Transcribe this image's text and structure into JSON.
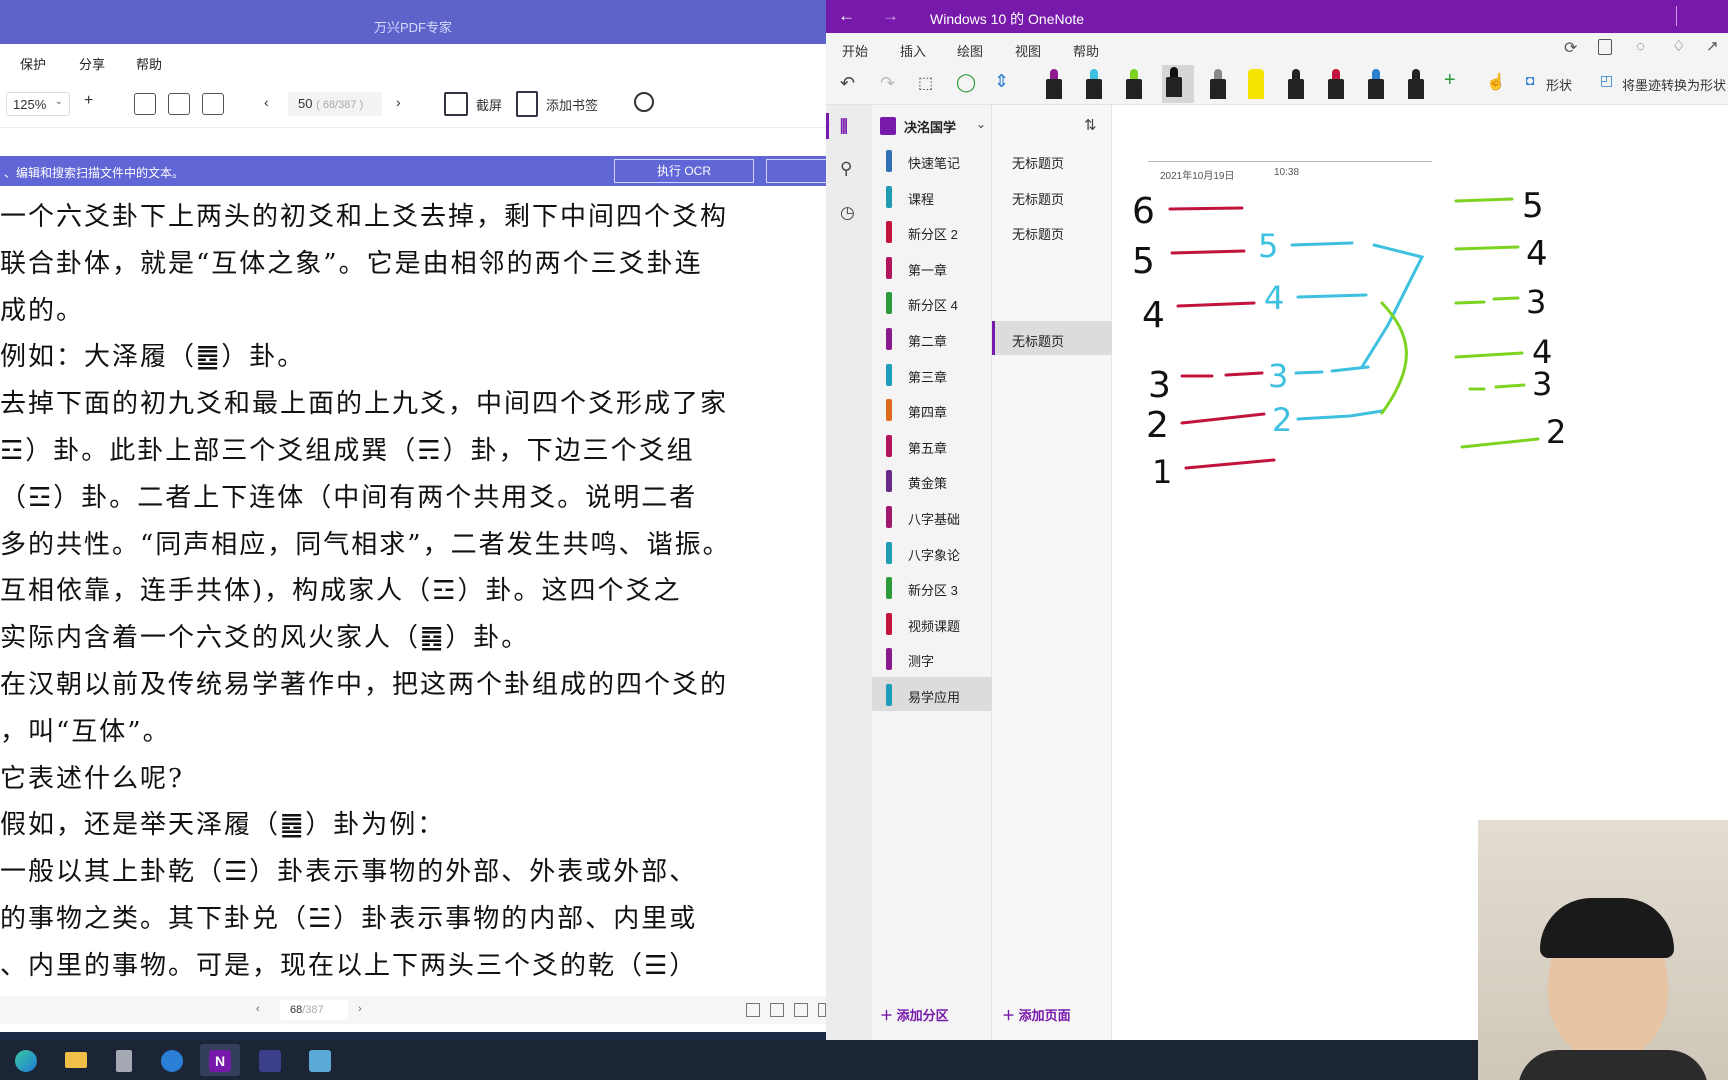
{
  "pdf": {
    "title": "万兴PDF专家",
    "menu": [
      "保护",
      "分享",
      "帮助"
    ],
    "zoom": "125%",
    "zoom_plus": "+",
    "page_current": "50",
    "page_range": "( 68/387 )",
    "screenshot_label": "截屏",
    "bookmark_label": "添加书签",
    "ocr_message": "、编辑和搜索扫描文件中的文本。",
    "ocr_button": "执行 OCR",
    "text_lines": [
      "一个六爻卦下上两头的初爻和上爻去掉，剩下中间四个爻构",
      "联合卦体，就是“互体之象”。它是由相邻的两个三爻卦连",
      "成的。",
      "例如：大泽履（䷉）卦。",
      "去掉下面的初九爻和最上面的上九爻，中间四个爻形成了家",
      "☲）卦。此卦上部三个爻组成巽（☴）卦，下边三个爻组",
      "（☲）卦。二者上下连体（中间有两个共用爻。说明二者",
      "多的共性。“同声相应，同气相求”，二者发生共鸣、谐振。",
      "互相依靠，连手共体)，构成家人（☲）卦。这四个爻之",
      "实际内含着一个六爻的风火家人（䷤）卦。",
      "在汉朝以前及传统易学著作中，把这两个卦组成的四个爻的",
      "，叫“互体”。",
      "它表述什么呢?",
      "假如，还是举天泽履（䷉）卦为例：",
      "一般以其上卦乾（☰）卦表示事物的外部、外表或外部、",
      "的事物之类。其下卦兑（☱）卦表示事物的内部、内里或",
      "、内里的事物。可是，现在以上下两头三个爻的乾（☰）"
    ],
    "status_page": "68",
    "status_total": "/387"
  },
  "onenote": {
    "title": "Windows 10 的 OneNote",
    "tabs": [
      "开始",
      "插入",
      "绘图",
      "视图",
      "帮助"
    ],
    "active_tab": "绘图",
    "ribbon_shape": "形状",
    "ribbon_convert": "将墨迹转换为形状",
    "notebook": "决洺国学",
    "sections": [
      {
        "label": "快速笔记",
        "color": "#2e6fb8"
      },
      {
        "label": "课程",
        "color": "#1f9bb2"
      },
      {
        "label": "新分区 2",
        "color": "#c4143c"
      },
      {
        "label": "第一章",
        "color": "#b1135d"
      },
      {
        "label": "新分区 4",
        "color": "#2a9a3a"
      },
      {
        "label": "第二章",
        "color": "#8b1a8f"
      },
      {
        "label": "第三章",
        "color": "#1c9dba"
      },
      {
        "label": "第四章",
        "color": "#e06a1c"
      },
      {
        "label": "第五章",
        "color": "#b1135d"
      },
      {
        "label": "黄金策",
        "color": "#6a2a8a"
      },
      {
        "label": "八字基础",
        "color": "#a0186e"
      },
      {
        "label": "八字象论",
        "color": "#1f9bb2"
      },
      {
        "label": "新分区 3",
        "color": "#2a9a3a"
      },
      {
        "label": "视频课题",
        "color": "#c4143c"
      },
      {
        "label": "测字",
        "color": "#8b1a8f"
      },
      {
        "label": "易学应用",
        "color": "#1c9dba"
      }
    ],
    "active_section": "易学应用",
    "pages": [
      "无标题页",
      "无标题页",
      "无标题页",
      "",
      "",
      "无标题页"
    ],
    "active_page_index": 5,
    "add_section": "添加分区",
    "add_page": "添加页面",
    "note_date": "2021年10月19日",
    "note_time": "10:38",
    "ink_numbers_left": [
      "6",
      "5",
      "4",
      "3",
      "2",
      "1"
    ],
    "ink_numbers_mid": [
      "5",
      "4",
      "3",
      "2"
    ],
    "ink_numbers_right": [
      "5",
      "4",
      "3",
      "4",
      "3",
      "2"
    ]
  },
  "colors": {
    "pdf_accent": "#5d63c9",
    "onenote_purple": "#7719aa",
    "ink_red": "#c0143c",
    "ink_blue": "#3ec0e0",
    "ink_green": "#7ed321"
  }
}
